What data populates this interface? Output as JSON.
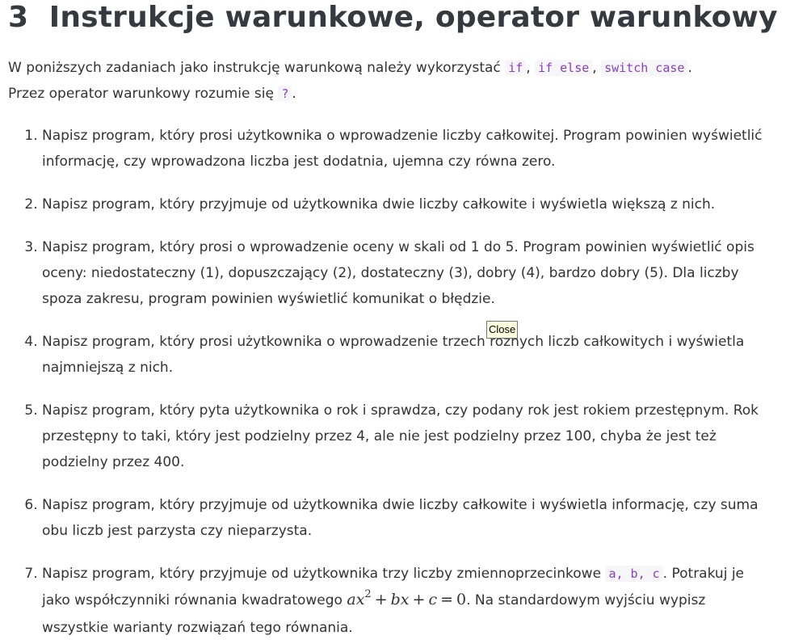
{
  "heading": {
    "number": "3",
    "text": "Instrukcje warunkowe, operator warunkowy"
  },
  "intro": {
    "line1_prefix": "W poniższych zadaniach jako instrukcję warunkową należy wykorzystać",
    "code_if": "if",
    "code_if_else": "if else",
    "code_switch": "switch case",
    "line2_prefix": "Przez operator warunkowy rozumie się",
    "code_ternary": "?"
  },
  "tasks": [
    {
      "text": "Napisz program, który prosi użytkownika o wprowadzenie liczby całkowitej. Program powinien wyświetlić informację, czy wprowadzona liczba jest dodatnia, ujemna czy równa zero."
    },
    {
      "text": "Napisz program, który przyjmuje od użytkownika dwie liczby całkowite i wyświetla większą z nich."
    },
    {
      "text": "Napisz program, który prosi o wprowadzenie oceny w skali od 1 do 5. Program powinien wyświetlić opis oceny: niedostateczny (1), dopuszczający (2), dostateczny (3), dobry (4), bardzo dobry (5). Dla liczby spoza zakresu, program powinien wyświetlić komunikat o błędzie."
    },
    {
      "text": "Napisz program, który prosi użytkownika o wprowadzenie trzech różnych liczb całkowitych i wyświetla najmniejszą z nich."
    },
    {
      "text": "Napisz program, który pyta użytkownika o rok i sprawdza, czy podany rok jest rokiem przestępnym. Rok przestępny to taki, który jest podzielny przez 4, ale nie jest podzielny przez 100, chyba że jest też podzielny przez 400."
    },
    {
      "text": "Napisz program, który przyjmuje od użytkownika dwie liczby całkowite i wyświetla informację, czy suma obu liczb jest parzysta czy nieparzysta."
    },
    {
      "text_before_code": "Napisz program, który przyjmuje od użytkownika trzy liczby zmiennoprzecinkowe",
      "code": "a, b, c",
      "text_after_code": ". Potrakuj je jako współczynniki równania kwadratowego",
      "equation": {
        "a": "ax",
        "exp": "2",
        "plus1": "+",
        "b": "bx",
        "plus2": "+",
        "c": "c",
        "eq": "=",
        "zero": "0"
      },
      "text_end": ". Na standardowym wyjściu wypisz wszystkie warianty rozwiązań tego równania."
    }
  ],
  "tooltip": {
    "label": "Close"
  },
  "colors": {
    "heading": "#343a40",
    "text": "#333333",
    "code": "#8a3ec2",
    "code_background": "#f6f6f8",
    "tooltip_background": "#ffffe1"
  }
}
